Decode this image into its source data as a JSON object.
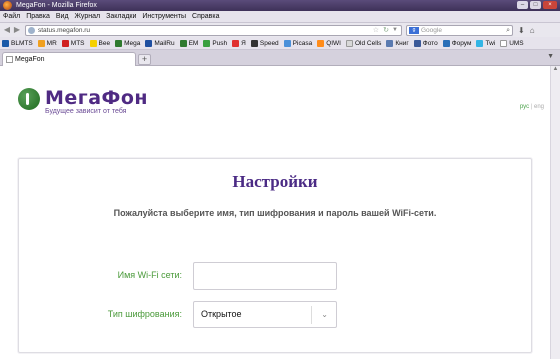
{
  "window": {
    "title": "MegaFon - Mozilla Firefox"
  },
  "menu": [
    "Файл",
    "Правка",
    "Вид",
    "Журнал",
    "Закладки",
    "Инструменты",
    "Справка"
  ],
  "nav": {
    "url": "status.megafon.ru",
    "search_placeholder": "Google"
  },
  "bookmarks": [
    "BLMTS",
    "MR",
    "MTS",
    "Bee",
    "Mega",
    "MailRu",
    "EM",
    "Push",
    "Я",
    "Speed",
    "Picasa",
    "QIWI",
    "Old Cells",
    "Книг",
    "Фото",
    "Форум",
    "Twi",
    "UMS"
  ],
  "tab": {
    "title": "MegaFon"
  },
  "logo": {
    "name": "МегаФон",
    "tagline": "Будущее зависит от тебя"
  },
  "lang": {
    "rus": "рус",
    "sep": "|",
    "eng": "eng"
  },
  "settings": {
    "title": "Настройки",
    "subtitle": "Пожалуйста выберите имя, тип шифрования и пароль вашей WiFi-сети.",
    "ssid_label": "Имя Wi-Fi сети:",
    "ssid_value": "",
    "encryption_label": "Тип шифрования:",
    "encryption_value": "Открытое"
  },
  "colors": {
    "brand_purple": "#4f2a83",
    "brand_green": "#4a9a3a"
  }
}
